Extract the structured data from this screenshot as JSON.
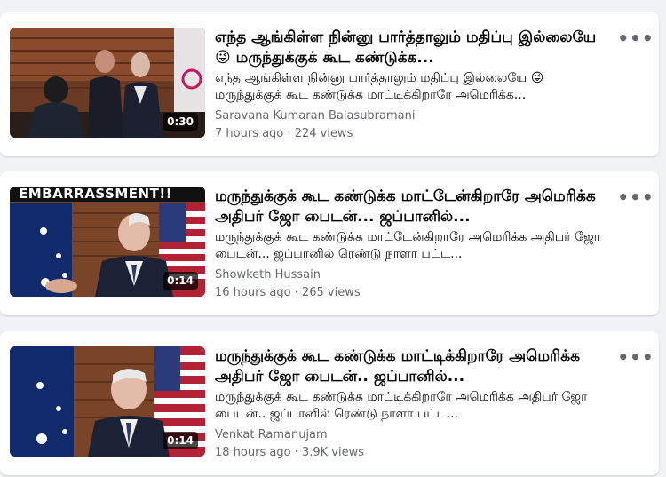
{
  "videos": [
    {
      "title": "எந்த ஆங்கிள்ள நின்னு பார்த்தாலும் மதிப்பு இல்லையே 😜 மருந்துக்குக் கூட கண்டுக்க...",
      "description": "எந்த ஆங்கிள்ள நின்னு பார்த்தாலும் மதிப்பு இல்லையே 😜 மருந்துக்குக் கூட கண்டுக்க மாட்டிக்கிறாரே அமெரிக்க...",
      "author": "Saravana Kumaran Balasubramani",
      "age": "7 hours ago",
      "separator": "·",
      "views": "224 views",
      "duration": "0:30",
      "banner": ""
    },
    {
      "title": "மருந்துக்குக் கூட கண்டுக்க மாட்டேன்கிறாரே அமெரிக்க அதிபர் ஜோ பைடன்... ஜப்பானில்...",
      "description": "மருந்துக்குக் கூட கண்டுக்க மாட்டேன்கிறாரே அமெரிக்க அதிபர் ஜோ பைடன்... ஜப்பானில் ரெண்டு நாளா பட்ட...",
      "author": "Showketh Hussain",
      "age": "16 hours ago",
      "separator": "·",
      "views": "265 views",
      "duration": "0:14",
      "banner": "EMBARRASSMENT!!"
    },
    {
      "title": "மருந்துக்குக் கூட கண்டுக்க மாட்டிக்கிறாரே அமெரிக்க அதிபர் ஜோ பைடன்.. ஜப்பானில்...",
      "description": "மருந்துக்குக் கூட கண்டுக்க மாட்டிக்கிறாரே அமெரிக்க அதிபர் ஜோ பைடன்.. ஜப்பானில் ரெண்டு நாளா பட்ட...",
      "author": "Venkat Ramanujam",
      "age": "18 hours ago",
      "separator": "·",
      "views": "3.9K views",
      "duration": "0:14",
      "banner": ""
    }
  ],
  "more_glyph": "•••",
  "colors": {
    "background": "#f0f2f5",
    "card": "#ffffff",
    "title_text": "#050505",
    "secondary_text": "#65676b",
    "duration_badge": "#000000"
  }
}
